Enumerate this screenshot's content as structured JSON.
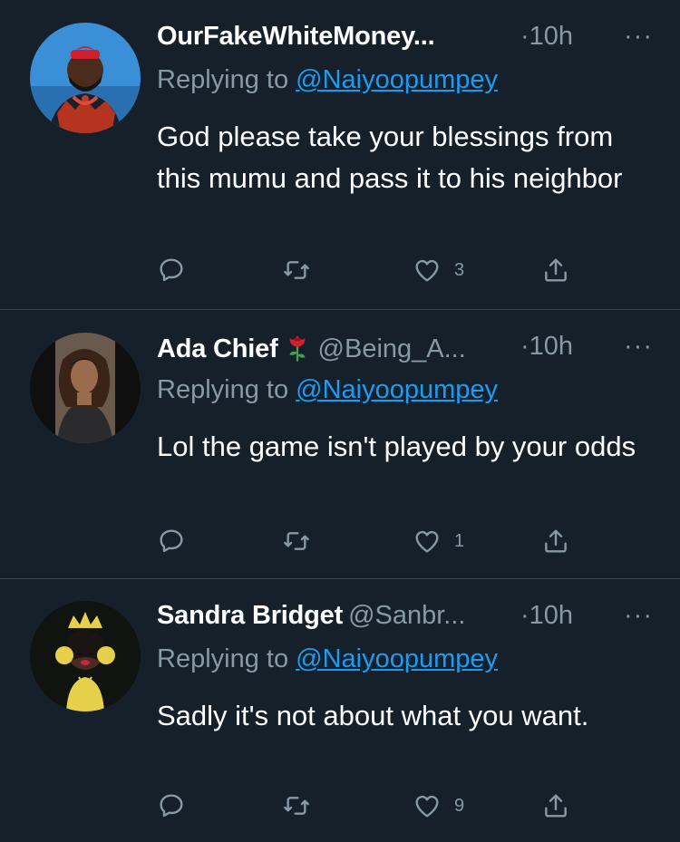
{
  "tweets": [
    {
      "name": "OurFakeWhiteMoney...",
      "handle": "",
      "time": "·10h",
      "more": "···",
      "reply_prefix": "Replying to",
      "reply_to": "@Naiyoopumpey",
      "text": "God please take your blessings from this mumu and pass it to his neighbor",
      "likes": "3"
    },
    {
      "name": "Ada Chief",
      "name_emoji": "rose-icon",
      "handle": "@Being_A...",
      "time": "·10h",
      "more": "···",
      "reply_prefix": "Replying to",
      "reply_to": "@Naiyoopumpey",
      "text": "Lol the game isn't played by your odds",
      "likes": "1"
    },
    {
      "name": "Sandra Bridget",
      "handle": "@Sanbr...",
      "time": "·10h",
      "more": "···",
      "reply_prefix": "Replying to",
      "reply_to": "@Naiyoopumpey",
      "text": "Sadly it's not about what you want.",
      "likes": "9"
    }
  ],
  "icons": [
    "reply-icon",
    "retweet-icon",
    "like-icon",
    "share-icon"
  ],
  "colors": {
    "background": "#15202b",
    "secondary_text": "#8899a6",
    "link": "#1d9bf0",
    "divider": "#38444d"
  }
}
